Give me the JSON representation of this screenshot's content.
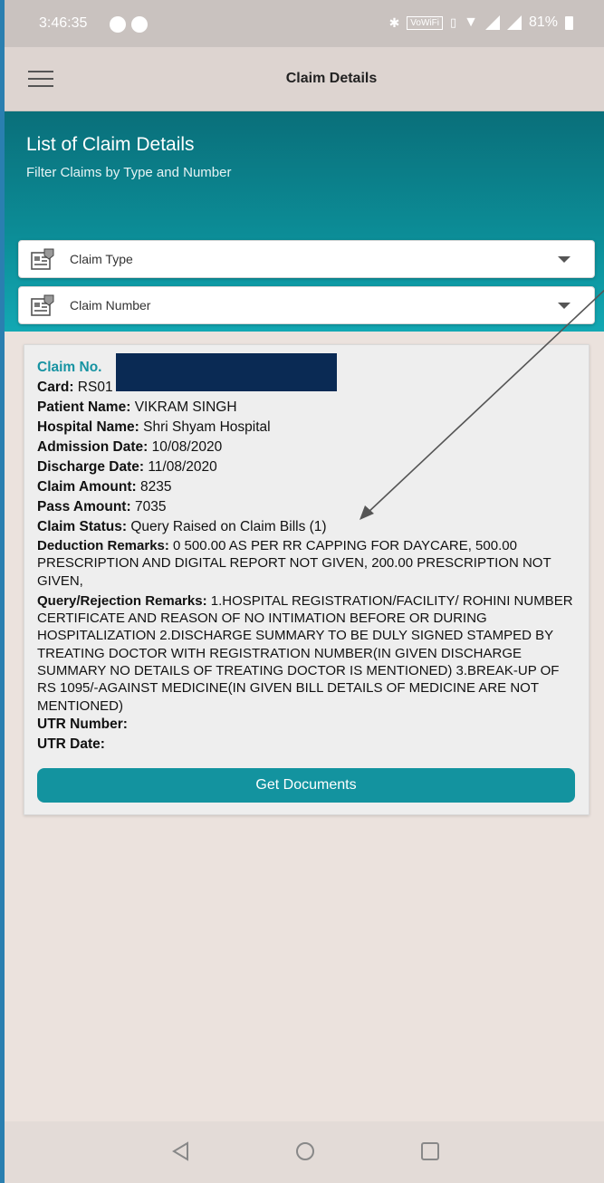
{
  "status_bar": {
    "time": "3:46:35",
    "wifi_badge": "VoWiFi",
    "battery": "81%"
  },
  "app_bar": {
    "title": "Claim Details"
  },
  "banner": {
    "title": "List of Claim Details",
    "subtitle": "Filter Claims by Type and Number"
  },
  "filters": {
    "claim_type_label": "Claim Type",
    "claim_number_label": "Claim Number"
  },
  "claim": {
    "claim_no_label": "Claim No.",
    "card_label": "Card:",
    "card_value": "RS01",
    "patient_label": "Patient Name:",
    "patient_value": "VIKRAM SINGH",
    "hospital_label": "Hospital Name:",
    "hospital_value": "Shri Shyam Hospital",
    "admission_label": "Admission Date:",
    "admission_value": "10/08/2020",
    "discharge_label": "Discharge Date:",
    "discharge_value": "11/08/2020",
    "amount_label": "Claim Amount:",
    "amount_value": "8235",
    "pass_label": "Pass Amount:",
    "pass_value": "7035",
    "status_label": "Claim Status:",
    "status_value": "Query Raised on Claim Bills (1)",
    "deduction_label": "Deduction Remarks:",
    "deduction_value": "0 500.00 AS PER RR CAPPING FOR DAYCARE, 500.00 PRESCRIPTION AND DIGITAL REPORT NOT GIVEN, 200.00 PRESCRIPTION NOT GIVEN,",
    "query_label": "Query/Rejection Remarks:",
    "query_value": "1.HOSPITAL REGISTRATION/FACILITY/ ROHINI NUMBER CERTIFICATE AND REASON OF NO INTIMATION BEFORE OR DURING HOSPITALIZATION 2.DISCHARGE SUMMARY TO BE DULY SIGNED STAMPED BY TREATING DOCTOR WITH REGISTRATION NUMBER(IN GIVEN DISCHARGE SUMMARY NO DETAILS OF TREATING DOCTOR IS MENTIONED) 3.BREAK-UP OF RS 1095/-AGAINST MEDICINE(IN GIVEN BILL DETAILS OF MEDICINE ARE NOT MENTIONED)",
    "utr_number_label": "UTR Number:",
    "utr_date_label": "UTR Date:",
    "get_documents_label": "Get Documents"
  },
  "colors": {
    "accent": "#13939f",
    "banner_dark": "#0a6f7a",
    "claim_no": "#1793a2",
    "redaction": "#0a2a54"
  }
}
